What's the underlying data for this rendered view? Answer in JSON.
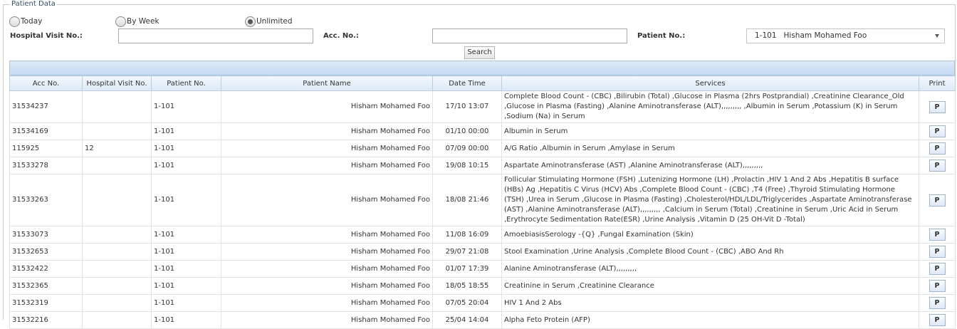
{
  "form": {
    "legend": "Patient Data",
    "radio_today": "Today",
    "radio_by_week": "By Week",
    "radio_unlimited": "Unlimited",
    "selected_range": "Unlimited",
    "hospital_visit_label": "Hospital Visit No.:",
    "hospital_visit_value": "",
    "acc_no_label": "Acc. No.:",
    "acc_no_value": "",
    "patient_no_label": "Patient No.:",
    "patient_select_value": "1-101   Hisham Mohamed Foo",
    "search_button": "Search"
  },
  "grid": {
    "columns": [
      "Acc No.",
      "Hospital Visit No.",
      "Patient No.",
      "Patient Name",
      "Date Time",
      "Services",
      "Print"
    ],
    "print_label": "P",
    "rows": [
      {
        "acc": "31534237",
        "visit": "",
        "patient_no": "1-101",
        "name": "Hisham Mohamed Foo",
        "datetime": "17/10 13:07",
        "services": "Complete Blood Count - (CBC) ,Bilirubin (Total) ,Glucose in Plasma (2hrs Postprandial) ,Creatinine Clearance_Old ,Glucose in Plasma (Fasting) ,Alanine Aminotransferase (ALT),,,,,,,,, ,Albumin in Serum ,Potassium (K) in Serum ,Sodium (Na) in Serum"
      },
      {
        "acc": "31534169",
        "visit": "",
        "patient_no": "1-101",
        "name": "Hisham Mohamed Foo",
        "datetime": "01/10 00:00",
        "services": "Albumin in Serum"
      },
      {
        "acc": "115925",
        "visit": "12",
        "patient_no": "1-101",
        "name": "Hisham Mohamed Foo",
        "datetime": "07/09 00:00",
        "services": "A/G Ratio ,Albumin in Serum ,Amylase in Serum"
      },
      {
        "acc": "31533278",
        "visit": "",
        "patient_no": "1-101",
        "name": "Hisham Mohamed Foo",
        "datetime": "19/08 10:15",
        "services": "Aspartate Aminotransferase (AST) ,Alanine Aminotransferase (ALT),,,,,,,,,"
      },
      {
        "acc": "31533263",
        "visit": "",
        "patient_no": "1-101",
        "name": "Hisham Mohamed Foo",
        "datetime": "18/08 21:46",
        "services": "Follicular Stimulating Hormone (FSH) ,Lutenizing Hormone (LH) ,Prolactin ,HIV 1 And 2 Abs ,Hepatitis B surface (HBs) Ag ,Hepatitis C Virus (HCV) Abs ,Complete Blood Count - (CBC) ,T4 (Free) ,Thyroid Stimulating Hormone (TSH) ,Urea in Serum ,Glucose in Plasma (Fasting) ,Cholesterol/HDL/LDL/Triglycerides ,Aspartate Aminotransferase (AST) ,Alanine Aminotransferase (ALT),,,,,,,,, ,Calcium in Serum (Total) ,Creatinine in Serum ,Uric Acid in Serum ,Erythrocyte Sedimentation Rate(ESR) ,Urine Analysis ,Vitamin D (25 OH-Vit D -Total)"
      },
      {
        "acc": "31533073",
        "visit": "",
        "patient_no": "1-101",
        "name": "Hisham Mohamed Foo",
        "datetime": "11/08 16:09",
        "services": "AmoebiasisSerology -{Q} ,Fungal Examination (Skin)"
      },
      {
        "acc": "31532653",
        "visit": "",
        "patient_no": "1-101",
        "name": "Hisham Mohamed Foo",
        "datetime": "29/07 21:08",
        "services": "Stool Examination ,Urine Analysis ,Complete Blood Count - (CBC) ,ABO And Rh"
      },
      {
        "acc": "31532422",
        "visit": "",
        "patient_no": "1-101",
        "name": "Hisham Mohamed Foo",
        "datetime": "01/07 17:39",
        "services": "Alanine Aminotransferase (ALT),,,,,,,,,"
      },
      {
        "acc": "31532365",
        "visit": "",
        "patient_no": "1-101",
        "name": "Hisham Mohamed Foo",
        "datetime": "18/05 18:55",
        "services": "Creatinine in Serum ,Creatinine Clearance"
      },
      {
        "acc": "31532319",
        "visit": "",
        "patient_no": "1-101",
        "name": "Hisham Mohamed Foo",
        "datetime": "07/05 20:04",
        "services": "HIV 1 And 2 Abs"
      },
      {
        "acc": "31532216",
        "visit": "",
        "patient_no": "1-101",
        "name": "Hisham Mohamed Foo",
        "datetime": "25/04 14:04",
        "services": "Alpha Feto Protein (AFP)"
      }
    ]
  }
}
